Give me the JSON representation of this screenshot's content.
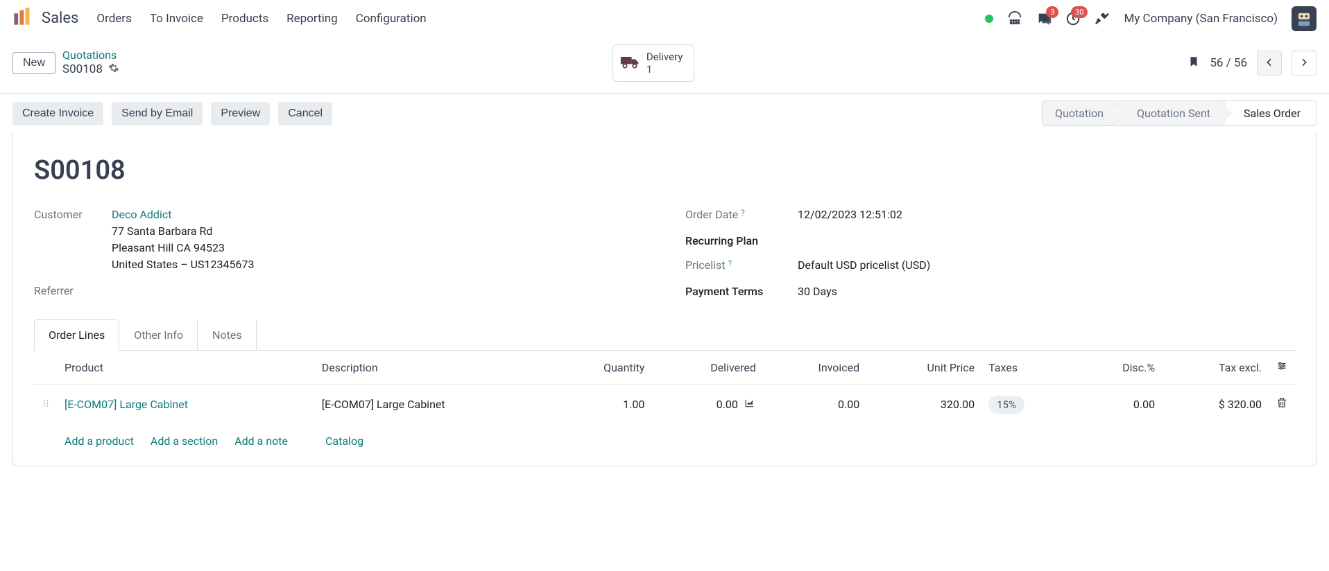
{
  "nav": {
    "app_name": "Sales",
    "menu": [
      "Orders",
      "To Invoice",
      "Products",
      "Reporting",
      "Configuration"
    ],
    "messages_badge": "3",
    "activities_badge": "30",
    "company": "My Company (San Francisco)"
  },
  "control": {
    "new_btn": "New",
    "breadcrumb_parent": "Quotations",
    "breadcrumb_current": "S00108",
    "stat_title": "Delivery",
    "stat_value": "1",
    "pager": "56 / 56"
  },
  "actions": {
    "create_invoice": "Create Invoice",
    "send_email": "Send by Email",
    "preview": "Preview",
    "cancel": "Cancel"
  },
  "status_steps": {
    "quotation": "Quotation",
    "quotation_sent": "Quotation Sent",
    "sales_order": "Sales Order"
  },
  "record": {
    "title": "S00108",
    "customer_label": "Customer",
    "customer_name": "Deco Addict",
    "customer_addr1": "77 Santa Barbara Rd",
    "customer_addr2": "Pleasant Hill CA 94523",
    "customer_addr3": "United States – US12345673",
    "referrer_label": "Referrer",
    "order_date_label": "Order Date",
    "order_date_value": "12/02/2023 12:51:02",
    "recurring_plan_label": "Recurring Plan",
    "pricelist_label": "Pricelist",
    "pricelist_value": "Default USD pricelist (USD)",
    "payment_terms_label": "Payment Terms",
    "payment_terms_value": "30 Days"
  },
  "tabs": {
    "order_lines": "Order Lines",
    "other_info": "Other Info",
    "notes": "Notes"
  },
  "table": {
    "headers": {
      "product": "Product",
      "description": "Description",
      "quantity": "Quantity",
      "delivered": "Delivered",
      "invoiced": "Invoiced",
      "unit_price": "Unit Price",
      "taxes": "Taxes",
      "disc": "Disc.%",
      "tax_excl": "Tax excl."
    },
    "row": {
      "product": "[E-COM07] Large Cabinet",
      "description": "[E-COM07] Large Cabinet",
      "quantity": "1.00",
      "delivered": "0.00",
      "invoiced": "0.00",
      "unit_price": "320.00",
      "taxes": "15%",
      "disc": "0.00",
      "tax_excl": "$ 320.00"
    },
    "add_product": "Add a product",
    "add_section": "Add a section",
    "add_note": "Add a note",
    "catalog": "Catalog"
  }
}
